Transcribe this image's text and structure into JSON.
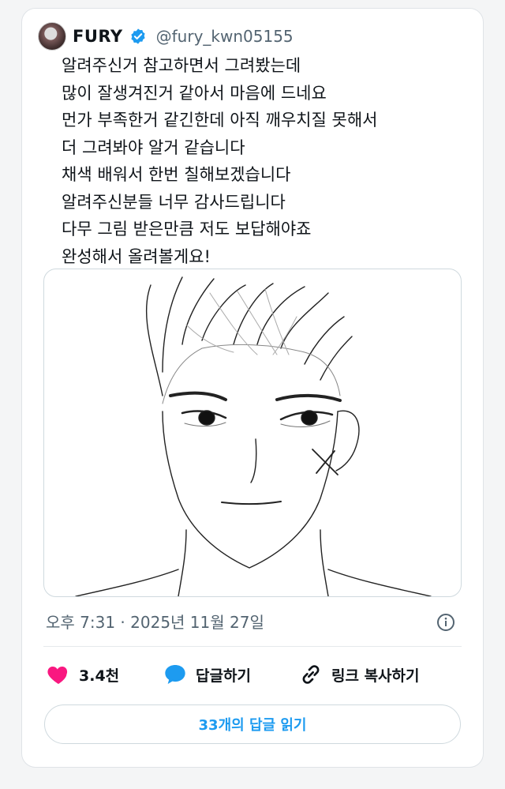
{
  "tweet": {
    "author_name": "FURY",
    "author_handle": "@fury_kwn05155",
    "verified": true,
    "text_lines": [
      "알려주신거 참고하면서 그려봤는데",
      "많이 잘생겨진거 같아서 마음에 드네요",
      "먼가 부족한거 같긴한데 아직 깨우치질 못해서",
      "더 그려봐야 알거 같습니다",
      "채색 배워서 한번 칠해보겠습니다",
      "알려주신분들 너무 감사드립니다",
      "다무 그림 받은만큼 저도 보답해야죠",
      "완성해서 올려볼게요!"
    ],
    "media": {
      "description_icon": "pencil-sketch-face-image"
    },
    "timestamp": "오후 7:31 · 2025년 11월 27일"
  },
  "actions": {
    "like_count": "3.4천",
    "reply_label": "답글하기",
    "copy_link_label": "링크 복사하기"
  },
  "read_replies_label": "33개의 답글 읽기",
  "colors": {
    "accent": "#1d9bf0",
    "like": "#f91880",
    "muted": "#536471"
  }
}
